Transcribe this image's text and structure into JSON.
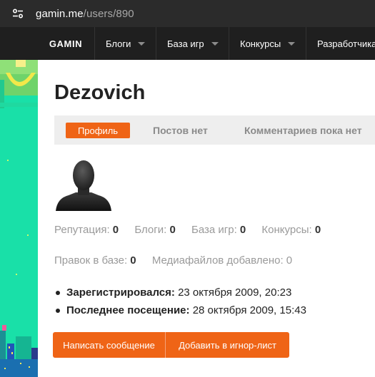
{
  "browser": {
    "url_domain": "gamin.me",
    "url_path": "/users/890",
    "site_info_icon": "tune-icon"
  },
  "nav": {
    "logo": "GAMIN",
    "items": [
      {
        "label": "Блоги"
      },
      {
        "label": "База игр"
      },
      {
        "label": "Конкурсы"
      },
      {
        "label": "Разработчикам"
      }
    ]
  },
  "profile": {
    "username": "Dezovich",
    "tabs": {
      "active": "Профиль",
      "posts": "Постов нет",
      "comments": "Комментариев пока нет"
    },
    "stats_row1": [
      {
        "label": "Репутация:",
        "value": "0"
      },
      {
        "label": "Блоги:",
        "value": "0"
      },
      {
        "label": "База игр:",
        "value": "0"
      },
      {
        "label": "Конкурсы:",
        "value": "0"
      }
    ],
    "stats_row2": [
      {
        "label": "Правок в базе:",
        "value": "0"
      },
      {
        "label": "Медиафайлов добавлено:",
        "value": "0"
      }
    ],
    "info": [
      {
        "label": "Зарегистрировался:",
        "value": "23 октября 2009, 20:23"
      },
      {
        "label": "Последнее посещение:",
        "value": "28 октября 2009, 15:43"
      }
    ],
    "buttons": {
      "message": "Написать сообщение",
      "ignore": "Добавить в игнор-лист"
    }
  },
  "colors": {
    "accent": "#ef6416",
    "nav_bg": "#1f1f1f",
    "art_bg": "#19e0a8"
  }
}
